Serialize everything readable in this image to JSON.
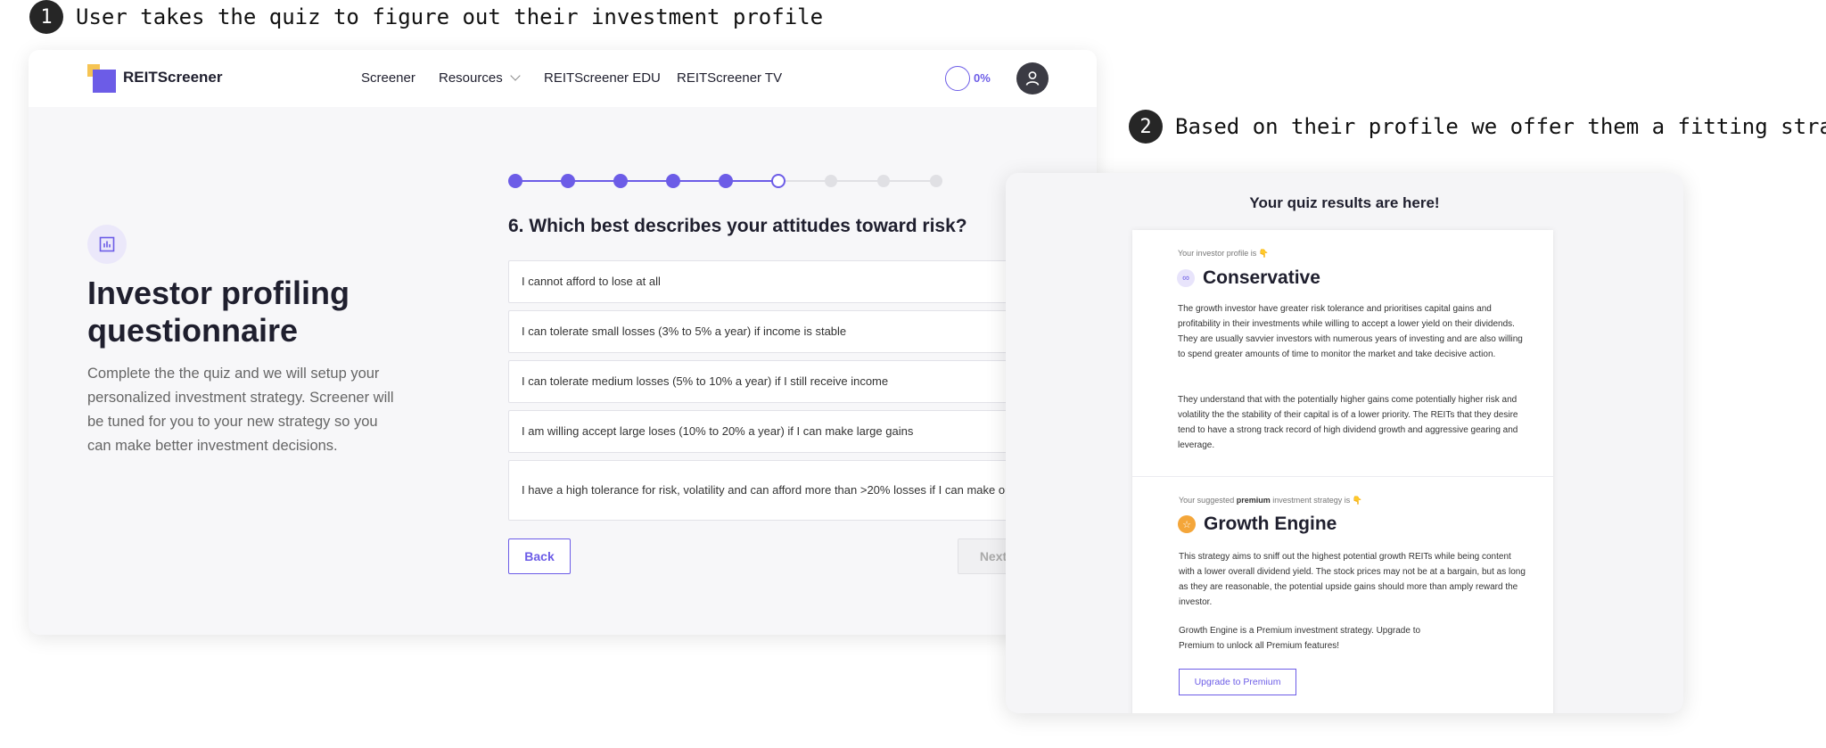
{
  "annotations": [
    {
      "number": "1",
      "text": "User takes the quiz to figure out their investment profile"
    },
    {
      "number": "2",
      "text": "Based on their profile we offer them a fitting strategy"
    }
  ],
  "nav": {
    "brand": "REITScreener",
    "items": [
      "Screener",
      "Resources",
      "REITScreener EDU",
      "REITScreener TV"
    ],
    "progress": "0%"
  },
  "intro": {
    "title": "Investor profiling questionnaire",
    "description": "Complete the the quiz and we will setup your personalized investment strategy. Screener will be tuned for you to your new strategy so you can make better investment decisions."
  },
  "quiz": {
    "total_steps": 9,
    "completed_steps": 5,
    "current_step": 6,
    "question": "6. Which best describes your attitudes toward risk?",
    "options": [
      "I cannot afford to lose at all",
      "I can tolerate small losses (3% to 5% a year) if income is stable",
      "I can tolerate medium losses (5% to 10% a year) if I still receive income",
      "I am willing accept large loses (10% to 20% a year) if I can make large gains",
      "I have a high tolerance for risk, volatility and can afford more than >20% losses if I can make outsized returns"
    ],
    "back_label": "Back",
    "next_label": "Next"
  },
  "results": {
    "title": "Your quiz results are here!",
    "profile_label": "Your investor profile is 👇",
    "profile_name": "Conservative",
    "profile_paragraphs": [
      "The growth investor have greater risk tolerance and prioritises capital gains and profitability in their investments while willing to accept a lower yield on their dividends. They are usually savvier investors with numerous years of investing and are also willing to spend greater amounts of time to monitor the market and take decisive action.",
      "They understand that with the potentially higher gains come potentially higher risk and volatility the the stability of their capital is of a lower priority. The REITs that they desire tend to have a strong track record of high dividend growth and aggressive gearing and leverage."
    ],
    "strategy_label_prefix": "Your suggested",
    "strategy_label_bold": "premium",
    "strategy_label_suffix": "investment strategy is 👇",
    "strategy_name": "Growth Engine",
    "strategy_paragraphs": [
      "This strategy aims to sniff out the highest potential growth REITs while being content with a lower overall dividend yield. The stock prices may not be at a bargain, but as long as they are reasonable, the potential upside gains should more than amply reward the investor.",
      "Growth Engine is a Premium investment strategy. Upgrade to Premium to unlock all Premium features!"
    ],
    "upgrade_label": "Upgrade to Premium"
  },
  "colors": {
    "accent": "#6c5ce7",
    "logo_yellow": "#f6c453",
    "strategy_icon": "#f4a63a"
  }
}
